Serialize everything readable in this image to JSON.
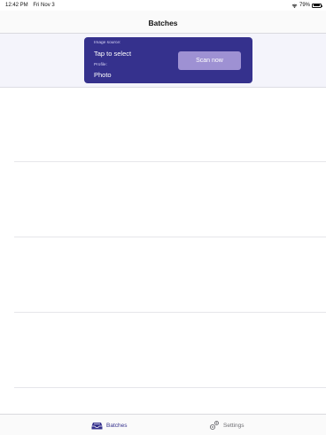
{
  "status_bar": {
    "time": "12:42 PM",
    "date": "Fri Nov 3",
    "battery": "79%",
    "battery_level": 0.79
  },
  "nav": {
    "title": "Batches"
  },
  "scan_panel": {
    "image_source_label": "Image source:",
    "image_source_value": "Tap to select",
    "profile_label": "Profile:",
    "profile_value": "Photo",
    "scan_button_label": "Scan now"
  },
  "tabs": [
    {
      "label": "Batches",
      "icon": "tray-icon",
      "selected": true
    },
    {
      "label": "Settings",
      "icon": "gears-icon",
      "selected": false
    }
  ],
  "colors": {
    "accent": "#35318d",
    "scan_button": "#9e91d3",
    "inactive_tab": "#6e6e73"
  }
}
